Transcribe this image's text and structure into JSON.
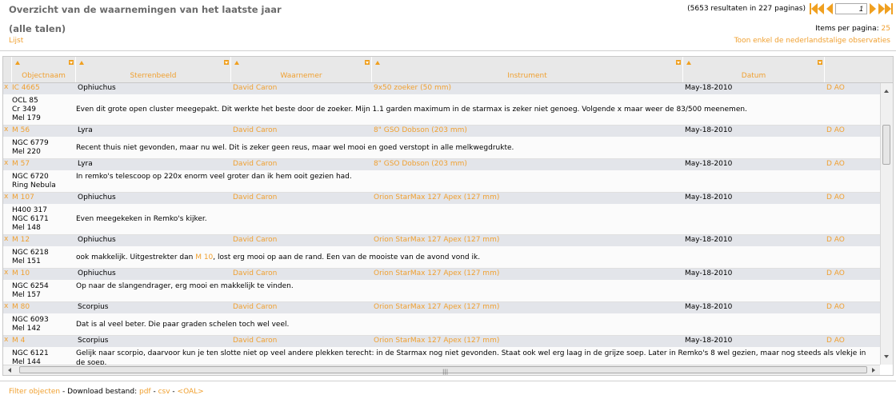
{
  "header": {
    "title": "Overzicht van de waarnemingen van het laatste jaar",
    "subtitle": "(alle talen)",
    "list_link": "Lijst",
    "results": "(5653 resultaten in 227 paginas)",
    "page_value": "1",
    "items_per_page_label": "Items per pagina:",
    "items_per_page_value": "25",
    "dutch_only_link": "Toon enkel de nederlandstalige observaties"
  },
  "columns": [
    "Objectnaam",
    "Sterrenbeeld",
    "Waarnemer",
    "Instrument",
    "Datum"
  ],
  "observations": [
    {
      "remove": "x",
      "object": "IC 4665",
      "constellation": "Ophiuchus",
      "observer": "David Caron",
      "instrument": "9x50 zoeker  (50 mm)",
      "date": "May-18-2010",
      "link": "D AO",
      "names": [
        "OCL 85",
        "Cr 349",
        "Mel 179"
      ],
      "description": "Even dit grote open cluster meegepakt. Dit werkte het beste door de zoeker. Mijn 1.1 garden maximum in de starmax is zeker niet genoeg. Volgende x maar weer de 83/500 meenemen."
    },
    {
      "remove": "x",
      "object": "M 56",
      "constellation": "Lyra",
      "observer": "David Caron",
      "instrument": "8\" GSO Dobson  (203 mm)",
      "date": "May-18-2010",
      "link": "D AO",
      "names": [
        "NGC 6779",
        "Mel 220"
      ],
      "description": "Recent thuis niet gevonden, maar nu wel. Dit is zeker geen reus, maar wel mooi en goed verstopt in alle melkwegdrukte."
    },
    {
      "remove": "x",
      "object": "M 57",
      "constellation": "Lyra",
      "observer": "David Caron",
      "instrument": "8\" GSO Dobson  (203 mm)",
      "date": "May-18-2010",
      "link": "D AO",
      "names": [
        "NGC 6720",
        "Ring Nebula"
      ],
      "description": "In remko's telescoop op 220x enorm veel groter dan ik hem ooit gezien had."
    },
    {
      "remove": "x",
      "object": "M 107",
      "constellation": "Ophiuchus",
      "observer": "David Caron",
      "instrument": "Orion StarMax 127 Apex  (127 mm)",
      "date": "May-18-2010",
      "link": "D AO",
      "names": [
        "H400 317",
        "NGC 6171",
        "Mel 148"
      ],
      "description": "Even meegekeken in Remko's kijker."
    },
    {
      "remove": "x",
      "object": "M 12",
      "constellation": "Ophiuchus",
      "observer": "David Caron",
      "instrument": "Orion StarMax 127 Apex  (127 mm)",
      "date": "May-18-2010",
      "link": "D AO",
      "names": [
        "NGC 6218",
        "Mel 151"
      ],
      "description_pre": "ook makkelijk. Uitgestrekter dan ",
      "description_link": "M 10",
      "description_post": ", lost erg mooi op aan de rand. Een van de mooiste van de avond vond ik."
    },
    {
      "remove": "x",
      "object": "M 10",
      "constellation": "Ophiuchus",
      "observer": "David Caron",
      "instrument": "Orion StarMax 127 Apex  (127 mm)",
      "date": "May-18-2010",
      "link": "D AO",
      "names": [
        "NGC 6254",
        "Mel 157"
      ],
      "description": "Op naar de slangendrager, erg mooi en makkelijk te vinden."
    },
    {
      "remove": "x",
      "object": "M 80",
      "constellation": "Scorpius",
      "observer": "David Caron",
      "instrument": "Orion StarMax 127 Apex  (127 mm)",
      "date": "May-18-2010",
      "link": "D AO",
      "names": [
        "NGC 6093",
        "Mel 142"
      ],
      "description": "Dat is al veel beter. Die paar graden schelen toch wel veel."
    },
    {
      "remove": "x",
      "object": "M 4",
      "constellation": "Scorpius",
      "observer": "David Caron",
      "instrument": "Orion StarMax 127 Apex  (127 mm)",
      "date": "May-18-2010",
      "link": "D AO",
      "names": [
        "NGC 6121",
        "Mel 144"
      ],
      "description": "Gelijk naar scorpio, daarvoor kun je ten slotte niet op veel andere plekken terecht: in de Starmax nog niet gevonden. Staat ook wel erg laag in de grijze soep. Later in Remko's 8 wel gezien, maar nog steeds als vlekje in de soep."
    }
  ],
  "footer": {
    "filter_link": "Filter objecten",
    "dash1": " - Download bestand: ",
    "pdf": "pdf",
    "dash2": " - ",
    "csv": "csv",
    "dash3": " - ",
    "oal": "<OAL>"
  },
  "colors": {
    "accent": "#f0a030",
    "row_bg": "#e3e5ea",
    "header_bg": "#e8e8e8",
    "title": "#6b6b6b"
  },
  "icons": [
    "first-page-icon",
    "prev-page-icon",
    "next-page-icon",
    "last-page-icon",
    "sort-up-icon",
    "column-menu-icon",
    "remove-icon"
  ]
}
